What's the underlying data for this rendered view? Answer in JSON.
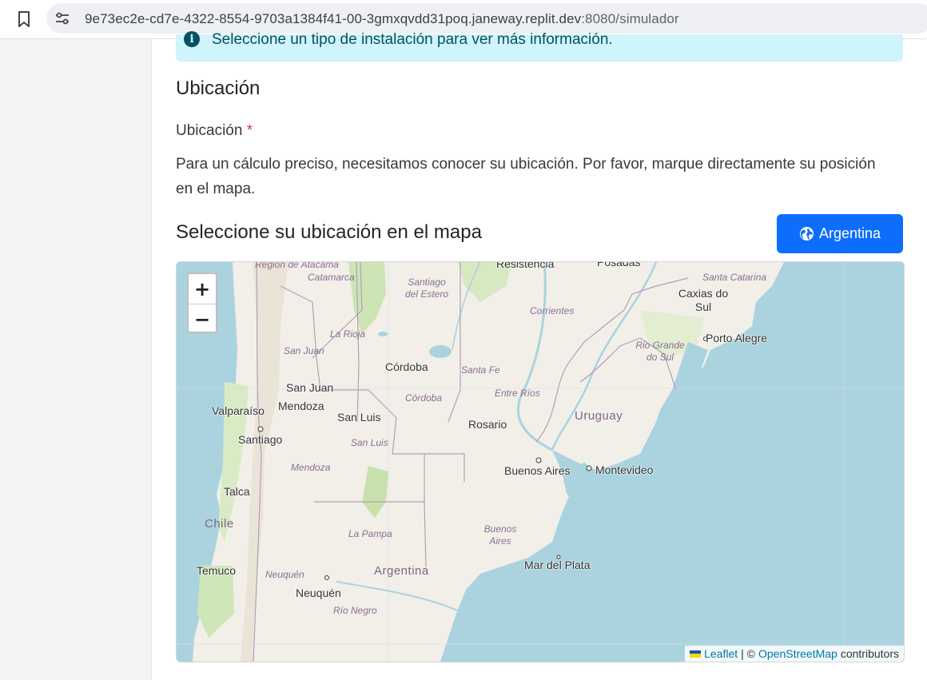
{
  "browser": {
    "url_main": "9e73ec2e-cd7e-4322-8554-9703a1384f41-00-3gmxqvdd31poq.janeway.replit.dev",
    "url_rest": ":8080/simulador"
  },
  "alert": {
    "text": "Seleccione un tipo de instalación para ver más información."
  },
  "section": {
    "title": "Ubicación",
    "field_label": "Ubicación",
    "required_mark": "*",
    "help": "Para un cálculo preciso, necesitamos conocer su ubicación. Por favor, marque directamente su posición en el mapa."
  },
  "map_section": {
    "title": "Seleccione su ubicación en el mapa",
    "button_label": "Argentina",
    "button_icon": "globe-icon",
    "button_color": "#0d6efd"
  },
  "map": {
    "zoom_in": "+",
    "zoom_out": "−",
    "attribution": {
      "leaflet": "Leaflet",
      "separator": "| ©",
      "osm": "OpenStreetMap",
      "suffix": "contributors"
    },
    "labels": {
      "region_atacama": "Región de Atacama",
      "catamarca": "Catamarca",
      "santiago_del_estero": "Santiago del Estero",
      "resistencia": "Resistencia",
      "posadas": "Posadas",
      "santa_catarina": "Santa Catarina",
      "caxias_do_sul": "Caxias do Sul",
      "corrientes": "Corrientes",
      "porto_alegre": "Porto Alegre",
      "la_rioja": "La Rioja",
      "rio_grande_do_sul": "Rio Grande do Sul",
      "san_juan_region": "San Juan",
      "cordoba_city": "Córdoba",
      "santa_fe": "Santa Fe",
      "san_juan_city": "San Juan",
      "entre_rios": "Entre Ríos",
      "cordoba_region": "Córdoba",
      "valparaiso": "Valparaíso",
      "mendoza_city": "Mendoza",
      "uruguay": "Uruguay",
      "san_luis_city": "San Luis",
      "rosario": "Rosario",
      "santiago": "Santiago",
      "san_luis_region": "San Luis",
      "mendoza_region": "Mendoza",
      "buenos_aires_city": "Buenos Aires",
      "montevideo": "Montevideo",
      "talca": "Talca",
      "chile": "Chile",
      "la_pampa": "La Pampa",
      "buenos_aires_region": "Buenos Aires",
      "mar_del_plata": "Mar del Plata",
      "temuco": "Temuco",
      "neuquen_region": "Neuquén",
      "argentina": "Argentina",
      "neuquen_city": "Neuquén",
      "rio_negro": "Río Negro"
    }
  }
}
